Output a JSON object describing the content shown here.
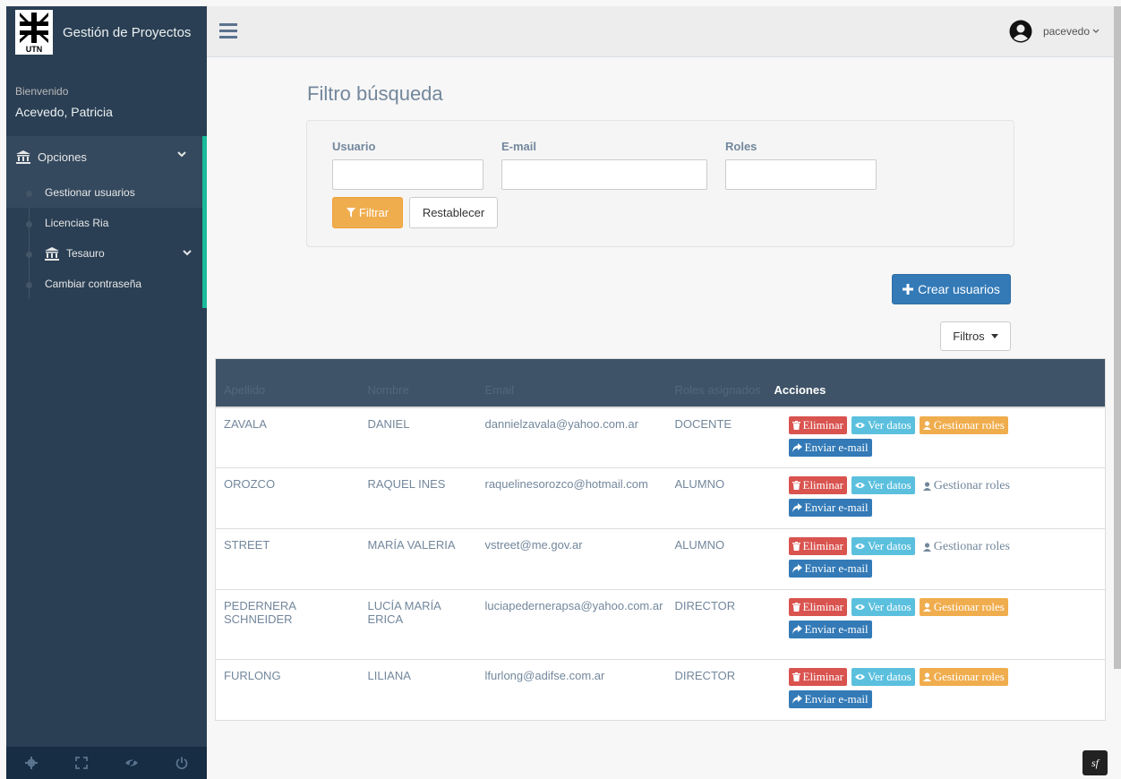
{
  "app": {
    "title": "Gestión de Proyectos",
    "logo_text": "UTN"
  },
  "welcome": {
    "label": "Bienvenido",
    "name": "Acevedo, Patricia"
  },
  "sidebar": {
    "section": "Opciones",
    "items": [
      {
        "label": "Gestionar usuarios"
      },
      {
        "label": "Licencias Ria"
      },
      {
        "label": "Tesauro"
      },
      {
        "label": "Cambiar contraseña"
      }
    ]
  },
  "topnav": {
    "username": "pacevedo"
  },
  "page": {
    "title": "Filtro búsqueda"
  },
  "filter": {
    "usuario_label": "Usuario",
    "usuario_value": "",
    "email_label": "E-mail",
    "email_value": "",
    "roles_label": "Roles",
    "roles_value": "",
    "filtrar_label": "Filtrar",
    "reset_label": "Restablecer"
  },
  "actions": {
    "crear_label": "Crear usuarios",
    "filtros_label": "Filtros"
  },
  "table": {
    "headers": [
      "Apellido",
      "Nombre",
      "Email",
      "Roles asignados",
      "Acciones"
    ],
    "btn_labels": {
      "eliminar": "Eliminar",
      "ver": "Ver datos",
      "roles": "Gestionar roles",
      "enviar": "Enviar e-mail"
    },
    "rows": [
      {
        "apellido": "ZAVALA",
        "nombre": "DANIEL",
        "email": "dannielzavala@yahoo.com.ar",
        "rol": "DOCENTE"
      },
      {
        "apellido": "OROZCO",
        "nombre": "RAQUEL INES",
        "email": "raquelinesorozco@hotmail.com",
        "rol": "ALUMNO"
      },
      {
        "apellido": "STREET",
        "nombre": "MARÍA VALERIA",
        "email": "vstreet@me.gov.ar",
        "rol": "ALUMNO"
      },
      {
        "apellido": "PEDERNERA SCHNEIDER",
        "nombre": "LUCÍA MARÍA ERICA",
        "email": "luciapedernerapsa@yahoo.com.ar",
        "rol": "DIRECTOR"
      },
      {
        "apellido": "FURLONG",
        "nombre": "LILIANA",
        "email": "lfurlong@adifse.com.ar",
        "rol": "DIRECTOR"
      }
    ]
  },
  "footer": {
    "sf_badge": "sf"
  },
  "colors": {
    "sidebar": "#2a3f54",
    "accent": "#1abb9c",
    "primary": "#337ab7",
    "danger": "#d9534f",
    "info": "#5bc0de",
    "warning": "#f0ad4e"
  }
}
